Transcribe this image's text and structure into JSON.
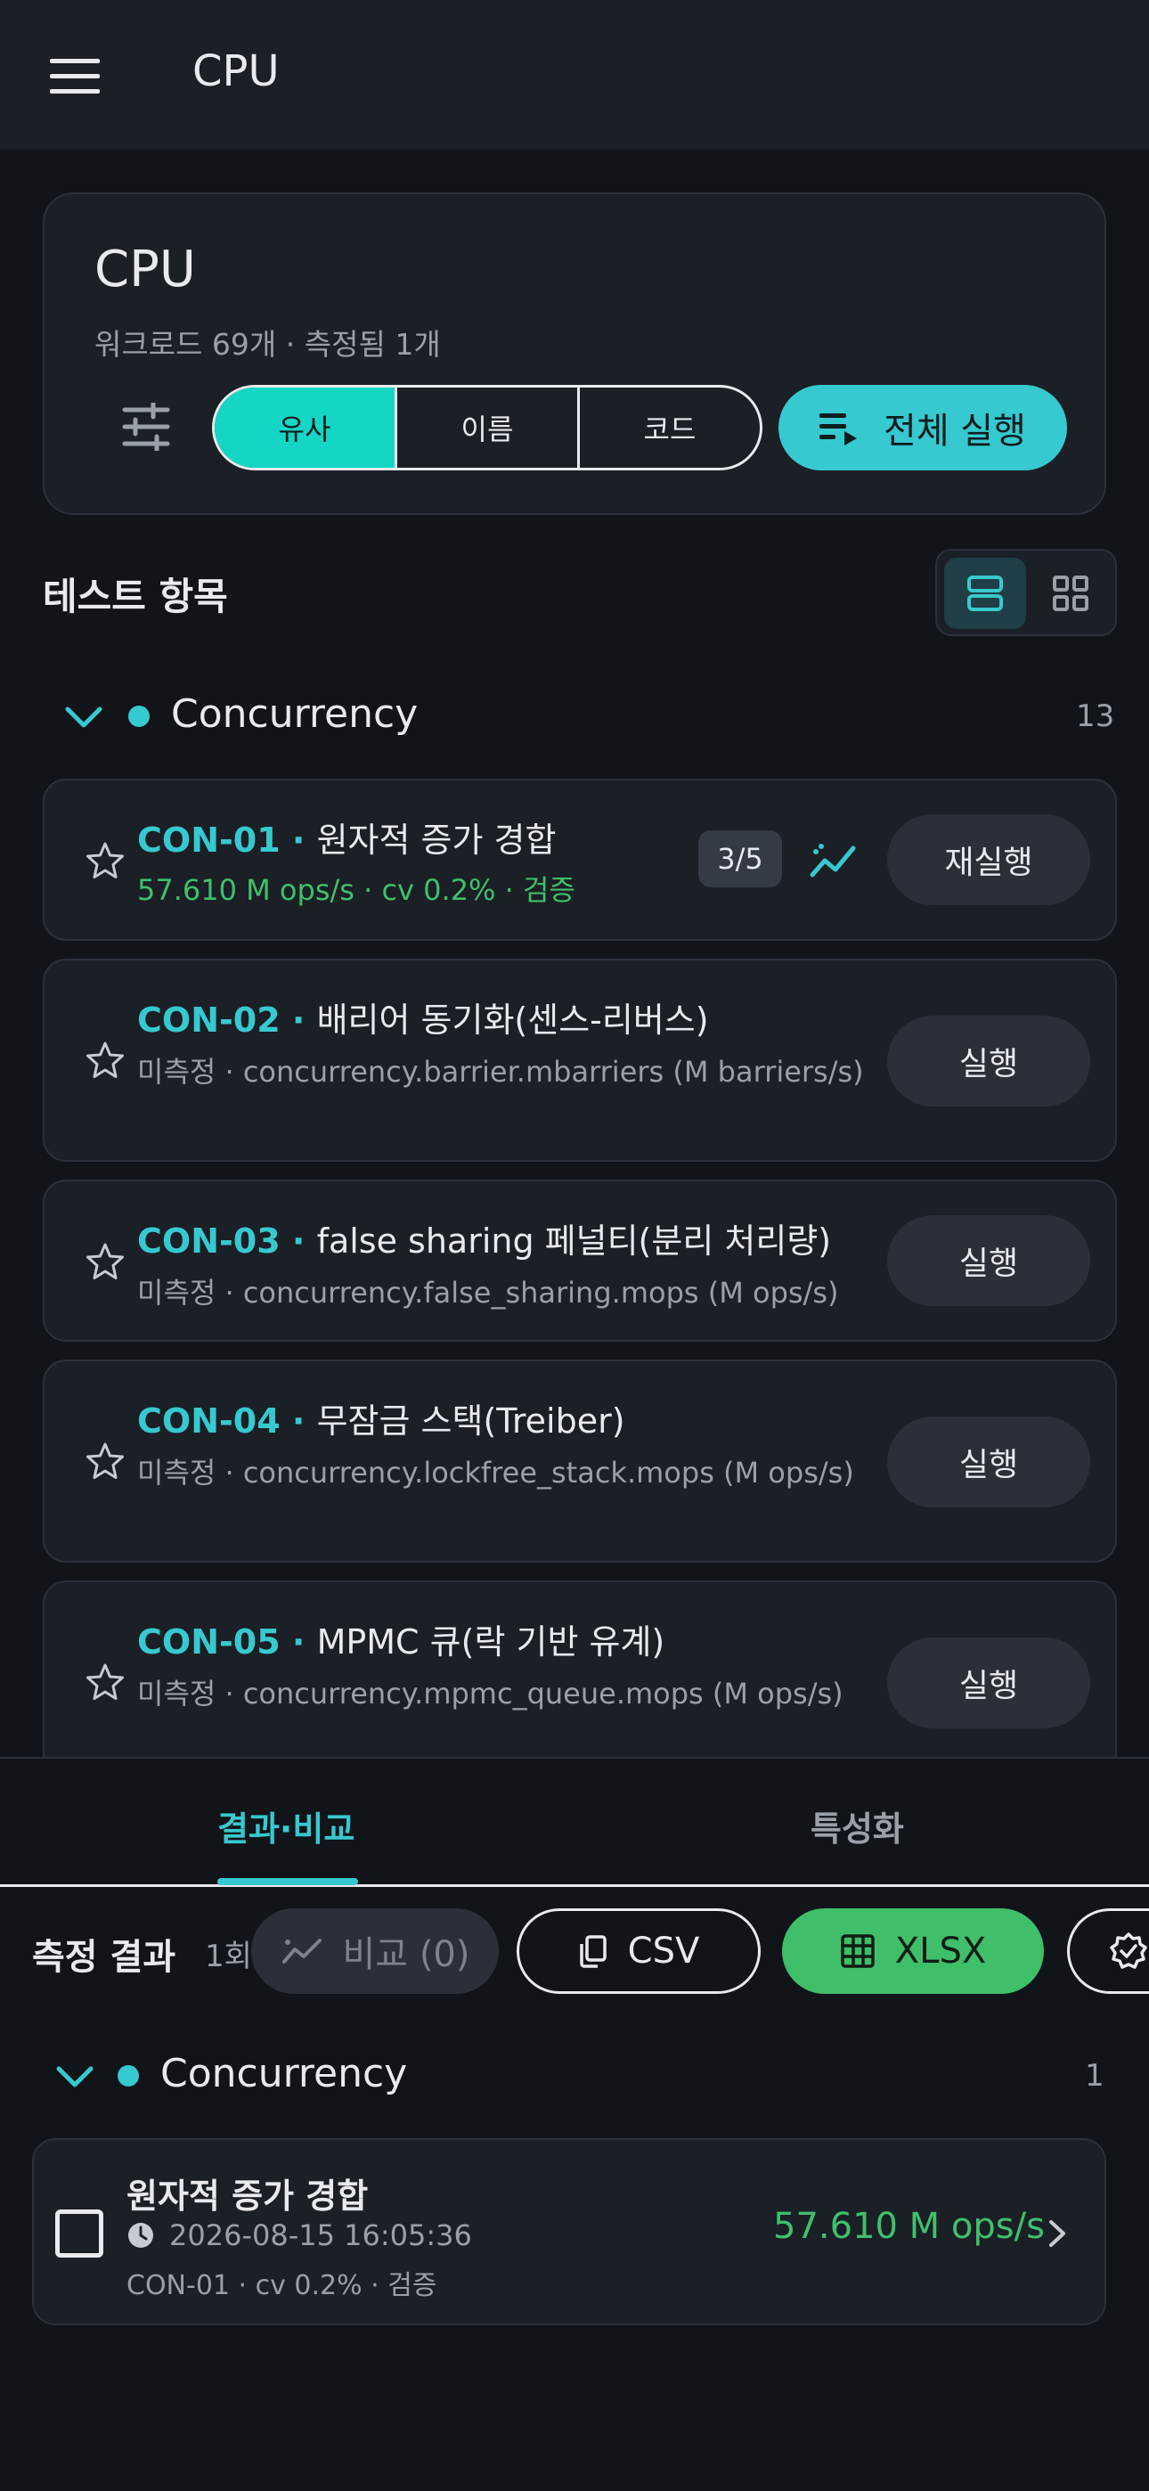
{
  "appbar": {
    "title": "CPU"
  },
  "summary": {
    "title": "CPU",
    "subtitle": "워크로드 69개 · 측정됨 1개",
    "sort_options": [
      "유사",
      "이름",
      "코드"
    ],
    "run_all_label": "전체 실행"
  },
  "tests": {
    "section_title": "테스트 항목",
    "group": {
      "name": "Concurrency",
      "count": "13"
    },
    "items": [
      {
        "code": "CON-01",
        "name": "원자적 증가 경합",
        "status": "57.610 M ops/s  ·  cv 0.2%  ·  검증",
        "progress": "3/5",
        "button": "재실행"
      },
      {
        "code": "CON-02",
        "name": "배리어 동기화(센스-리버스)",
        "status": "미측정  ·  concurrency.barrier.mbarriers (M barriers/s)",
        "button": "실행"
      },
      {
        "code": "CON-03",
        "name": "false sharing 페널티(분리 처리량)",
        "status": "미측정  ·  concurrency.false_sharing.mops (M ops/s)",
        "button": "실행"
      },
      {
        "code": "CON-04",
        "name": "무잠금 스택(Treiber)",
        "status": "미측정  ·  concurrency.lockfree_stack.mops (M ops/s)",
        "button": "실행"
      },
      {
        "code": "CON-05",
        "name": "MPMC 큐(락 기반 유계)",
        "status": "미측정  ·  concurrency.mpmc_queue.mops (M ops/s)",
        "button": "실행"
      }
    ]
  },
  "tabs": {
    "active": "결과·비교",
    "inactive": "특성화"
  },
  "results": {
    "title": "측정 결과",
    "count": "1회",
    "compare_label": "비교 (0)",
    "csv_label": "CSV",
    "xlsx_label": "XLSX",
    "group": {
      "name": "Concurrency",
      "count": "1"
    },
    "item": {
      "name": "원자적 증가 경합",
      "timestamp": "2026-08-15 16:05:36",
      "meta": "CON-01 · cv 0.2% · 검증",
      "value": "57.610 M ops/s"
    }
  },
  "colors": {
    "accent": "#36c9cf",
    "success": "#3fc06c",
    "segment_active": "#15d6c4",
    "background": "#111419",
    "card": "#1b1f26"
  }
}
